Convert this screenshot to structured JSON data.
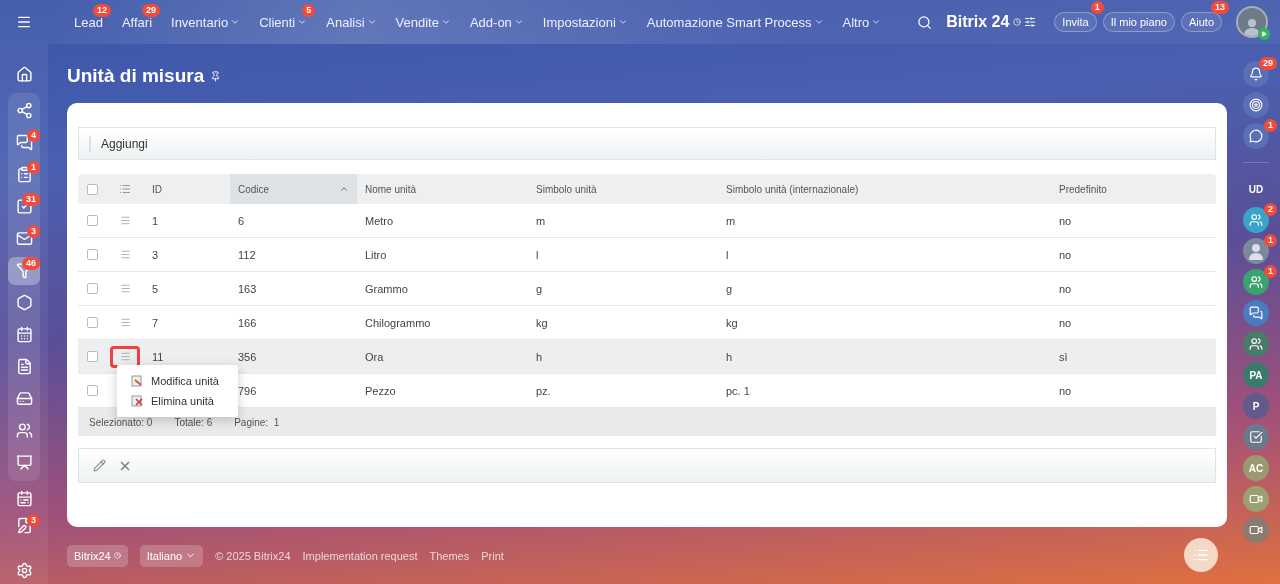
{
  "top_menu": [
    {
      "label": "Lead",
      "badge": "12",
      "dropdown": false
    },
    {
      "label": "Affari",
      "badge": "29",
      "dropdown": false
    },
    {
      "label": "Inventario",
      "dropdown": true
    },
    {
      "label": "Clienti",
      "badge": "5",
      "dropdown": true
    },
    {
      "label": "Analisi",
      "dropdown": true
    },
    {
      "label": "Vendite",
      "dropdown": true
    },
    {
      "label": "Add-on",
      "dropdown": true
    },
    {
      "label": "Impostazioni",
      "dropdown": true
    },
    {
      "label": "Automazione Smart Process",
      "dropdown": true
    },
    {
      "label": "Altro",
      "dropdown": true
    }
  ],
  "header_right": {
    "logo": "Bitrix 24",
    "buttons": [
      {
        "label": "Invita",
        "badge": "1"
      },
      {
        "label": "Il mio piano"
      },
      {
        "label": "Aiuto",
        "badge": "13"
      }
    ]
  },
  "left_sidebar": {
    "top": [
      {
        "kind": "home",
        "selected": false
      }
    ],
    "group": [
      {
        "kind": "nodes",
        "selected": false
      },
      {
        "kind": "chat",
        "badge": "4",
        "selected": false
      },
      {
        "kind": "feed",
        "badge": "1",
        "selected": false
      },
      {
        "kind": "tasks",
        "badge": "31",
        "selected": false
      },
      {
        "kind": "mail",
        "badge": "3",
        "selected": false
      },
      {
        "kind": "funnel",
        "badge": "46",
        "selected": true
      },
      {
        "kind": "hexagon",
        "selected": false
      },
      {
        "kind": "calendar",
        "selected": false
      },
      {
        "kind": "document",
        "selected": false
      },
      {
        "kind": "drive",
        "selected": false
      },
      {
        "kind": "users",
        "selected": false
      },
      {
        "kind": "board",
        "selected": false
      }
    ],
    "bottom": [
      {
        "kind": "schedule",
        "selected": false
      },
      {
        "kind": "edit",
        "badge": "3",
        "selected": false
      }
    ],
    "footer": [
      {
        "kind": "settings",
        "selected": false
      }
    ]
  },
  "right_sidebar": [
    {
      "kind": "bell",
      "badge": "29",
      "color": "#5a6fb5"
    },
    {
      "kind": "target",
      "color": "#5a6fb5"
    },
    {
      "kind": "chat",
      "badge": "1",
      "color": "#5a6fb5"
    },
    {
      "kind": "divider"
    },
    {
      "kind": "initials",
      "label": "UD",
      "color": "#55539a"
    },
    {
      "kind": "group",
      "badge": "2",
      "color": "#3aa3c8"
    },
    {
      "kind": "avatar",
      "badge": "1",
      "color": "#7a8a9a"
    },
    {
      "kind": "group",
      "badge": "1",
      "color": "#3aa36e"
    },
    {
      "kind": "messages",
      "color": "#4a7cc0"
    },
    {
      "kind": "group",
      "color": "#4a7a6a"
    },
    {
      "kind": "initials",
      "label": "PA",
      "color": "#3a7a6a"
    },
    {
      "kind": "initials",
      "label": "P",
      "color": "#625a8a"
    },
    {
      "kind": "check",
      "color": "#6a7a8a"
    },
    {
      "kind": "initials",
      "label": "AC",
      "color": "#9a9a70"
    },
    {
      "kind": "video",
      "color": "#9aa070"
    },
    {
      "kind": "video",
      "color": "#8a7a70"
    }
  ],
  "page": {
    "title": "Unità di misura"
  },
  "toolbar": {
    "add": "Aggiungi"
  },
  "table": {
    "all_checked": false,
    "columns": [
      {
        "label": "ID",
        "sorted": false
      },
      {
        "label": "Codice",
        "sorted": true
      },
      {
        "label": "Nome unità",
        "sorted": false
      },
      {
        "label": "Simbolo unità",
        "sorted": false
      },
      {
        "label": "Simbolo unità (internazionale)",
        "sorted": false
      },
      {
        "label": "Predefinito",
        "sorted": false
      }
    ],
    "rows": [
      {
        "checked": false,
        "highlighted": false,
        "cells": [
          "1",
          "6",
          "Metro",
          "m",
          "m",
          "no"
        ]
      },
      {
        "checked": false,
        "highlighted": false,
        "cells": [
          "3",
          "112",
          "Litro",
          "l",
          "l",
          "no"
        ]
      },
      {
        "checked": false,
        "highlighted": false,
        "cells": [
          "5",
          "163",
          "Grammo",
          "g",
          "g",
          "no"
        ]
      },
      {
        "checked": false,
        "highlighted": false,
        "cells": [
          "7",
          "166",
          "Chilogrammo",
          "kg",
          "kg",
          "no"
        ]
      },
      {
        "checked": false,
        "highlighted": true,
        "cells": [
          "11",
          "356",
          "Ora",
          "h",
          "h",
          "sì"
        ]
      },
      {
        "checked": false,
        "highlighted": false,
        "cells": [
          null,
          "796",
          "Pezzo",
          "pz.",
          "pc. 1",
          "no"
        ]
      }
    ],
    "footer": [
      "Selezionato: 0",
      "Totale: 6",
      "Pagine:  1"
    ],
    "context_menu": [
      {
        "kind": "edit",
        "label": "Modifica unità"
      },
      {
        "kind": "delete",
        "label": "Elimina unità"
      }
    ]
  },
  "footer": {
    "brand": "Bitrix24",
    "language": "Italiano",
    "copyright": "© 2025 Bitrix24",
    "links": [
      "Implementation request",
      "Themes",
      "Print"
    ]
  }
}
